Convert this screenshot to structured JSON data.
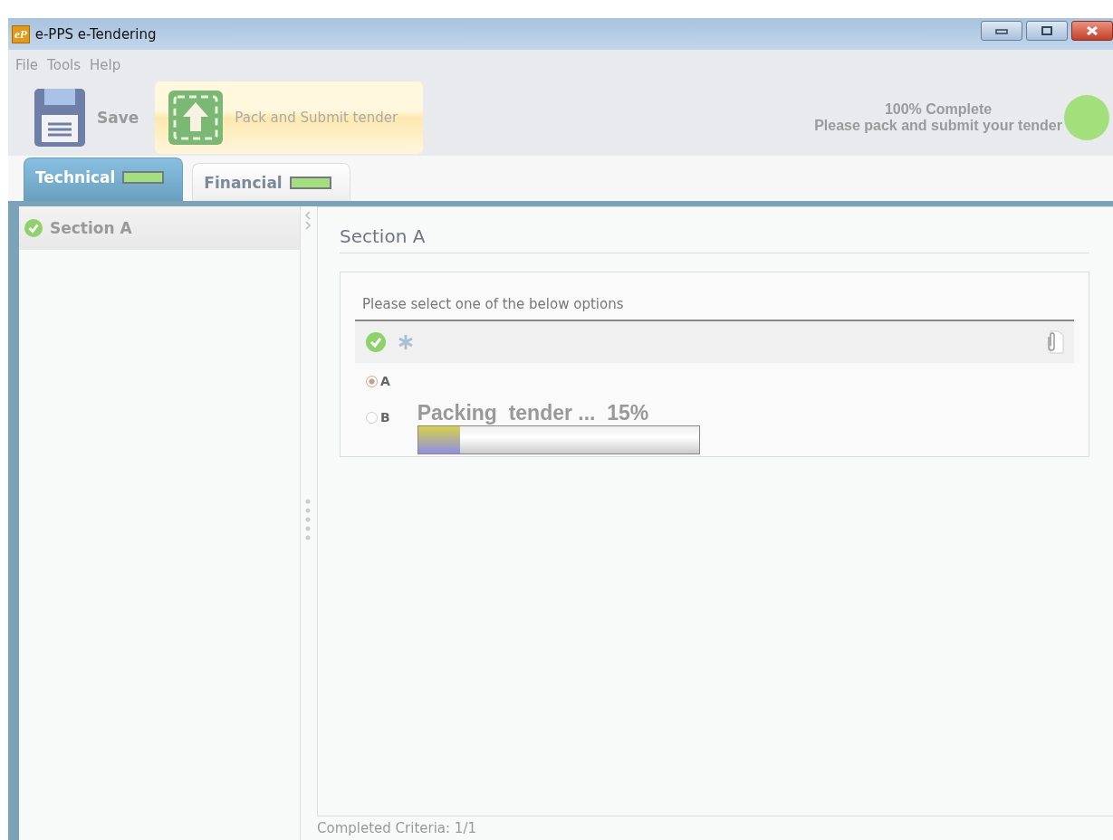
{
  "window": {
    "title": "e-PPS e-Tendering",
    "app_icon": "eP"
  },
  "menu": [
    "File",
    "Tools",
    "Help"
  ],
  "toolbar": {
    "buttons": [
      {
        "kind": "save",
        "label": "Save",
        "highlighted": false
      },
      {
        "kind": "submit",
        "label": "Pack and Submit tender",
        "highlighted": true
      }
    ],
    "status": {
      "headline": "100% Complete",
      "message": "Please pack and submit your tender",
      "color": "#a3e07c"
    }
  },
  "tabs": [
    {
      "label": "Technical",
      "selected": true,
      "level": 1
    },
    {
      "label": "Financial",
      "selected": false,
      "level": 1
    }
  ],
  "sidebar": {
    "items": [
      {
        "label": "Section A",
        "complete": true,
        "selected": true
      }
    ]
  },
  "content": {
    "title": "Section A",
    "question": "Please select one of the below options",
    "options": [
      {
        "label": "A",
        "selected": true
      },
      {
        "label": "B",
        "selected": false
      }
    ],
    "progress": {
      "text": "Packing  tender ...  15%",
      "level": 0.15
    },
    "footer": "Completed Criteria: 1/1"
  }
}
